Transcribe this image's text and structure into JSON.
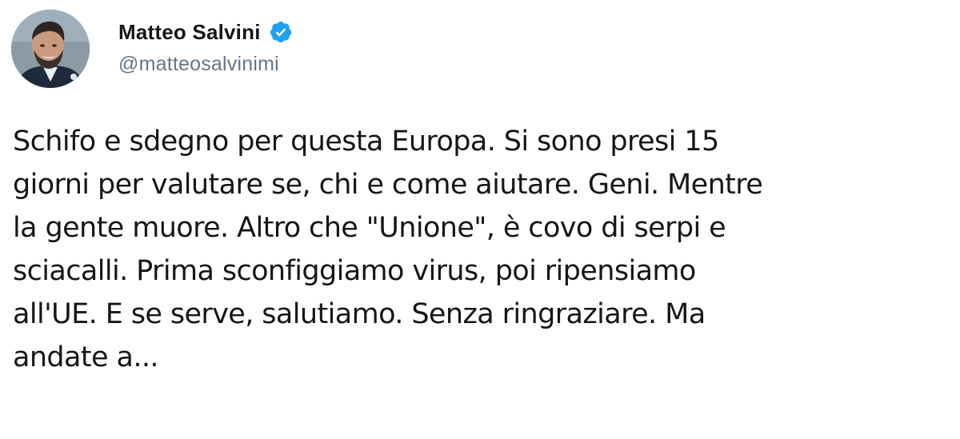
{
  "author": {
    "display_name": "Matteo Salvini",
    "handle": "@matteosalvinimi",
    "verified": true,
    "verified_icon": "verified-badge-icon",
    "accent_color": "#1da1f2"
  },
  "tweet": {
    "lines": [
      "Schifo e sdegno per questa Europa. Si sono presi 15",
      "giorni per valutare se, chi e come aiutare. Geni. Mentre",
      "la gente muore. Altro che \"Unione\", è covo di serpi e",
      "sciacalli. Prima sconfiggiamo virus, poi ripensiamo",
      "all'UE. E se serve, salutiamo. Senza ringraziare. Ma",
      "andate a..."
    ]
  }
}
